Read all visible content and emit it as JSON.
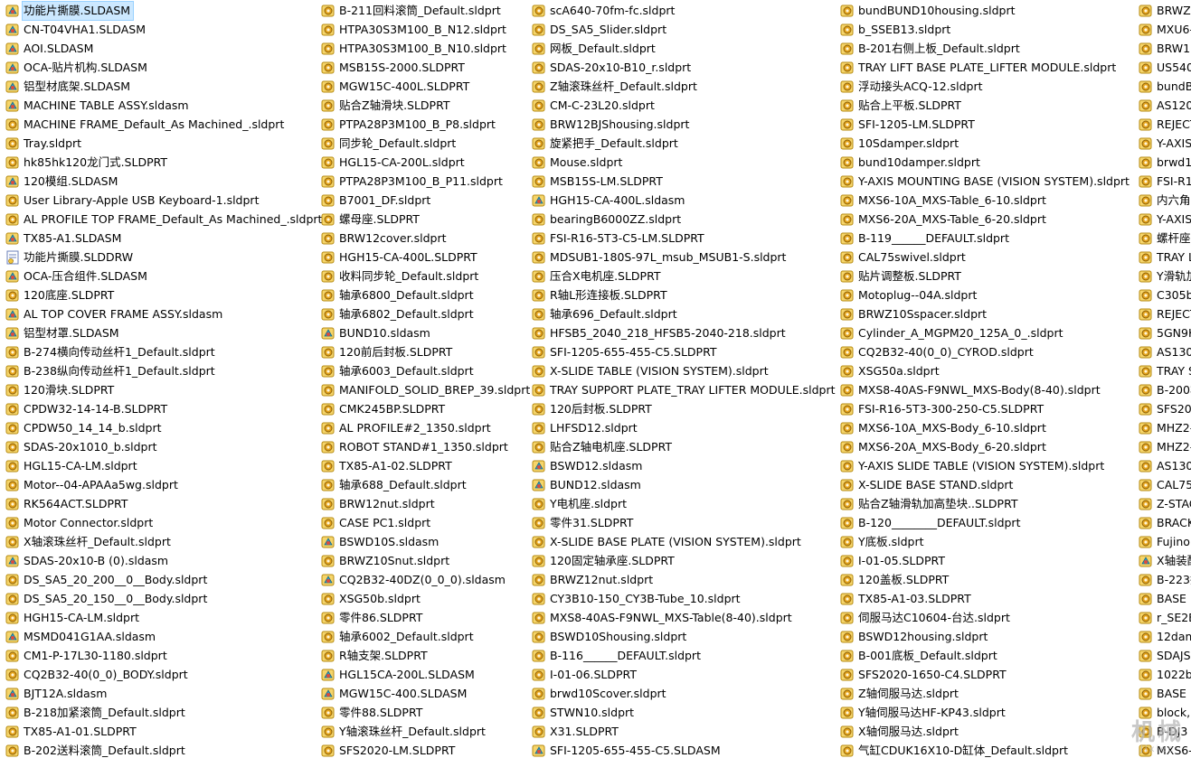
{
  "icon_kinds": {
    "a": "assembly-icon",
    "p": "part-icon",
    "d": "drawing-icon"
  },
  "colors": {
    "selection": "#cce8ff",
    "assembly": "#2fa0c8",
    "part": "#e3a21a",
    "drawing": "#6a7fb8"
  },
  "watermark": {
    "main": "机械",
    "sub": "Jixiec"
  },
  "columns": [
    [
      [
        "功能片撕膜.SLDASM",
        "a",
        true
      ],
      [
        "CN-T04VHA1.SLDASM",
        "a",
        false
      ],
      [
        "AOI.SLDASM",
        "a",
        false
      ],
      [
        "OCA-贴片机构.SLDASM",
        "a",
        false
      ],
      [
        "铝型材底架.SLDASM",
        "a",
        false
      ],
      [
        "MACHINE TABLE  ASSY.sldasm",
        "a",
        false
      ],
      [
        "MACHINE FRAME_Default_As Machined_.sldprt",
        "p",
        false
      ],
      [
        "Tray.sldprt",
        "p",
        false
      ],
      [
        "hk85hk120龙门式.SLDPRT",
        "p",
        false
      ],
      [
        "120模组.SLDASM",
        "a",
        false
      ],
      [
        "User Library-Apple USB Keyboard-1.sldprt",
        "p",
        false
      ],
      [
        "AL PROFILE TOP FRAME_Default_As Machined_.sldprt",
        "p",
        false
      ],
      [
        "TX85-A1.SLDASM",
        "a",
        false
      ],
      [
        "功能片撕膜.SLDDRW",
        "d",
        false
      ],
      [
        "OCA-压合组件.SLDASM",
        "a",
        false
      ],
      [
        "120底座.SLDPRT",
        "p",
        false
      ],
      [
        "AL TOP COVER FRAME  ASSY.sldasm",
        "a",
        false
      ],
      [
        "铝型材罩.SLDASM",
        "a",
        false
      ],
      [
        "B-274横向传动丝杆1_Default.sldprt",
        "p",
        false
      ],
      [
        "B-238纵向传动丝杆1_Default.sldprt",
        "p",
        false
      ],
      [
        "120滑块.SLDPRT",
        "p",
        false
      ],
      [
        "CPDW32-14-14-B.SLDPRT",
        "p",
        false
      ],
      [
        "CPDW50_14_14_b.sldprt",
        "p",
        false
      ],
      [
        "SDAS-20x1010_b.sldprt",
        "p",
        false
      ],
      [
        "HGL15-CA-LM.sldprt",
        "p",
        false
      ],
      [
        "Motor--04-APAAa5wg.sldprt",
        "p",
        false
      ],
      [
        "RK564ACT.SLDPRT",
        "p",
        false
      ],
      [
        "Motor Connector.sldprt",
        "p",
        false
      ],
      [
        "X轴滚珠丝杆_Default.sldprt",
        "p",
        false
      ],
      [
        "SDAS-20x10-B (0).sldasm",
        "a",
        false
      ],
      [
        "DS_SA5_20_200__0__Body.sldprt",
        "p",
        false
      ],
      [
        "DS_SA5_20_150__0__Body.sldprt",
        "p",
        false
      ],
      [
        "HGH15-CA-LM.sldprt",
        "p",
        false
      ],
      [
        "MSMD041G1AA.sldasm",
        "a",
        false
      ],
      [
        "CM1-P-17L30-1180.sldprt",
        "p",
        false
      ],
      [
        "CQ2B32-40(0_0)_BODY.sldprt",
        "p",
        false
      ],
      [
        "BJT12A.sldasm",
        "a",
        false
      ],
      [
        "B-218加紧滚筒_Default.sldprt",
        "p",
        false
      ],
      [
        "TX85-A1-01.SLDPRT",
        "p",
        false
      ],
      [
        "B-202送料滚筒_Default.sldprt",
        "p",
        false
      ]
    ],
    [
      [
        "B-211回料滚筒_Default.sldprt",
        "p",
        false
      ],
      [
        "HTPA30S3M100_B_N12.sldprt",
        "p",
        false
      ],
      [
        "HTPA30S3M100_B_N10.sldprt",
        "p",
        false
      ],
      [
        "MSB15S-2000.SLDPRT",
        "p",
        false
      ],
      [
        "MGW15C-400L.SLDPRT",
        "p",
        false
      ],
      [
        "贴合Z轴滑块.SLDPRT",
        "p",
        false
      ],
      [
        "PTPA28P3M100_B_P8.sldprt",
        "p",
        false
      ],
      [
        "同步轮_Default.sldprt",
        "p",
        false
      ],
      [
        "HGL15-CA-200L.sldprt",
        "p",
        false
      ],
      [
        "PTPA28P3M100_B_P11.sldprt",
        "p",
        false
      ],
      [
        "B7001_DF.sldprt",
        "p",
        false
      ],
      [
        "螺母座.SLDPRT",
        "p",
        false
      ],
      [
        "BRW12cover.sldprt",
        "p",
        false
      ],
      [
        "HGH15-CA-400L.SLDPRT",
        "p",
        false
      ],
      [
        "收料同步轮_Default.sldprt",
        "p",
        false
      ],
      [
        "轴承6800_Default.sldprt",
        "p",
        false
      ],
      [
        "轴承6802_Default.sldprt",
        "p",
        false
      ],
      [
        "BUND10.sldasm",
        "a",
        false
      ],
      [
        "120前后封板.SLDPRT",
        "p",
        false
      ],
      [
        "轴承6003_Default.sldprt",
        "p",
        false
      ],
      [
        "MANIFOLD_SOLID_BREP_39.sldprt",
        "p",
        false
      ],
      [
        "CMK245BP.SLDPRT",
        "p",
        false
      ],
      [
        "AL PROFILE#2_1350.sldprt",
        "p",
        false
      ],
      [
        "ROBOT STAND#1_1350.sldprt",
        "p",
        false
      ],
      [
        "TX85-A1-02.SLDPRT",
        "p",
        false
      ],
      [
        "轴承688_Default.sldprt",
        "p",
        false
      ],
      [
        "BRW12nut.sldprt",
        "p",
        false
      ],
      [
        "CASE PC1.sldprt",
        "p",
        false
      ],
      [
        "BSWD10S.sldasm",
        "a",
        false
      ],
      [
        "BRWZ10Snut.sldprt",
        "p",
        false
      ],
      [
        "CQ2B32-40DZ(0_0_0).sldasm",
        "a",
        false
      ],
      [
        "XSG50b.sldprt",
        "p",
        false
      ],
      [
        "零件86.SLDPRT",
        "p",
        false
      ],
      [
        "轴承6002_Default.sldprt",
        "p",
        false
      ],
      [
        "R轴支架.SLDPRT",
        "p",
        false
      ],
      [
        "HGL15CA-200L.SLDASM",
        "a",
        false
      ],
      [
        "MGW15C-400.SLDASM",
        "a",
        false
      ],
      [
        "零件88.SLDPRT",
        "p",
        false
      ],
      [
        "Y轴滚珠丝杆_Default.sldprt",
        "p",
        false
      ],
      [
        "SFS2020-LM.SLDPRT",
        "p",
        false
      ]
    ],
    [
      [
        "scA640-70fm-fc.sldprt",
        "p",
        false
      ],
      [
        "DS_SA5_Slider.sldprt",
        "p",
        false
      ],
      [
        "网板_Default.sldprt",
        "p",
        false
      ],
      [
        "SDAS-20x10-B10_r.sldprt",
        "p",
        false
      ],
      [
        "Z轴滚珠丝杆_Default.sldprt",
        "p",
        false
      ],
      [
        "CM-C-23L20.sldprt",
        "p",
        false
      ],
      [
        "BRW12BJShousing.sldprt",
        "p",
        false
      ],
      [
        "旋紧把手_Default.sldprt",
        "p",
        false
      ],
      [
        "Mouse.sldprt",
        "p",
        false
      ],
      [
        "MSB15S-LM.SLDPRT",
        "p",
        false
      ],
      [
        "HGH15-CA-400L.sldasm",
        "a",
        false
      ],
      [
        "bearingB6000ZZ.sldprt",
        "p",
        false
      ],
      [
        "FSI-R16-5T3-C5-LM.SLDPRT",
        "p",
        false
      ],
      [
        "MDSUB1-180S-97L_msub_MSUB1-S.sldprt",
        "p",
        false
      ],
      [
        "压合X电机座.SLDPRT",
        "p",
        false
      ],
      [
        "R轴L形连接板.SLDPRT",
        "p",
        false
      ],
      [
        "轴承696_Default.sldprt",
        "p",
        false
      ],
      [
        "HFSB5_2040_218_HFSB5-2040-218.sldprt",
        "p",
        false
      ],
      [
        "SFI-1205-655-455-C5.SLDPRT",
        "p",
        false
      ],
      [
        "X-SLIDE TABLE (VISION SYSTEM).sldprt",
        "p",
        false
      ],
      [
        "TRAY SUPPORT PLATE_TRAY  LIFTER MODULE.sldprt",
        "p",
        false
      ],
      [
        "120后封板.SLDPRT",
        "p",
        false
      ],
      [
        "LHFSD12.sldprt",
        "p",
        false
      ],
      [
        "贴合Z轴电机座.SLDPRT",
        "p",
        false
      ],
      [
        "BSWD12.sldasm",
        "a",
        false
      ],
      [
        "BUND12.sldasm",
        "a",
        false
      ],
      [
        "Y电机座.sldprt",
        "p",
        false
      ],
      [
        "零件31.SLDPRT",
        "p",
        false
      ],
      [
        "X-SLIDE BASE PLATE (VISION SYSTEM).sldprt",
        "p",
        false
      ],
      [
        "120固定轴承座.SLDPRT",
        "p",
        false
      ],
      [
        "BRWZ12nut.sldprt",
        "p",
        false
      ],
      [
        "CY3B10-150_CY3B-Tube_10.sldprt",
        "p",
        false
      ],
      [
        "MXS8-40AS-F9NWL_MXS-Table(8-40).sldprt",
        "p",
        false
      ],
      [
        "BSWD10Shousing.sldprt",
        "p",
        false
      ],
      [
        "B-116______DEFAULT.sldprt",
        "p",
        false
      ],
      [
        "I-01-06.SLDPRT",
        "p",
        false
      ],
      [
        "brwd10Scover.sldprt",
        "p",
        false
      ],
      [
        "STWN10.sldprt",
        "p",
        false
      ],
      [
        "X31.SLDPRT",
        "p",
        false
      ],
      [
        "SFI-1205-655-455-C5.SLDASM",
        "a",
        false
      ]
    ],
    [
      [
        "bundBUND10housing.sldprt",
        "p",
        false
      ],
      [
        "b_SSEB13.sldprt",
        "p",
        false
      ],
      [
        "B-201右侧上板_Default.sldprt",
        "p",
        false
      ],
      [
        "TRAY LIFT BASE PLATE_LIFTER MODULE.sldprt",
        "p",
        false
      ],
      [
        "浮动接头ACQ-12.sldprt",
        "p",
        false
      ],
      [
        "贴合上平板.SLDPRT",
        "p",
        false
      ],
      [
        "SFI-1205-LM.SLDPRT",
        "p",
        false
      ],
      [
        "10Sdamper.sldprt",
        "p",
        false
      ],
      [
        "bund10damper.sldprt",
        "p",
        false
      ],
      [
        "Y-AXIS MOUNTING BASE (VISION SYSTEM).sldprt",
        "p",
        false
      ],
      [
        "MXS6-10A_MXS-Table_6-10.sldprt",
        "p",
        false
      ],
      [
        "MXS6-20A_MXS-Table_6-20.sldprt",
        "p",
        false
      ],
      [
        "B-119______DEFAULT.sldprt",
        "p",
        false
      ],
      [
        "CAL75swivel.sldprt",
        "p",
        false
      ],
      [
        "贴片调整板.SLDPRT",
        "p",
        false
      ],
      [
        "Motoplug--04A.sldprt",
        "p",
        false
      ],
      [
        "BRWZ10Sspacer.sldprt",
        "p",
        false
      ],
      [
        "Cylinder_A_MGPM20_125A_0_.sldprt",
        "p",
        false
      ],
      [
        "CQ2B32-40(0_0)_CYROD.sldprt",
        "p",
        false
      ],
      [
        "XSG50a.sldprt",
        "p",
        false
      ],
      [
        "MXS8-40AS-F9NWL_MXS-Body(8-40).sldprt",
        "p",
        false
      ],
      [
        "FSI-R16-5T3-300-250-C5.SLDPRT",
        "p",
        false
      ],
      [
        "MXS6-10A_MXS-Body_6-10.sldprt",
        "p",
        false
      ],
      [
        "MXS6-20A_MXS-Body_6-20.sldprt",
        "p",
        false
      ],
      [
        "Y-AXIS SLIDE TABLE (VISION SYSTEM).sldprt",
        "p",
        false
      ],
      [
        "X-SLIDE BASE STAND.sldprt",
        "p",
        false
      ],
      [
        "贴合Z轴滑轨加高垫块..SLDPRT",
        "p",
        false
      ],
      [
        "B-120________DEFAULT.sldprt",
        "p",
        false
      ],
      [
        "Y底板.sldprt",
        "p",
        false
      ],
      [
        "I-01-05.SLDPRT",
        "p",
        false
      ],
      [
        "120盖板.SLDPRT",
        "p",
        false
      ],
      [
        "TX85-A1-03.SLDPRT",
        "p",
        false
      ],
      [
        "伺服马达C10604-台达.sldprt",
        "p",
        false
      ],
      [
        "BSWD12housing.sldprt",
        "p",
        false
      ],
      [
        "B-001底板_Default.sldprt",
        "p",
        false
      ],
      [
        "SFS2020-1650-C4.SLDPRT",
        "p",
        false
      ],
      [
        "Z轴伺服马达.sldprt",
        "p",
        false
      ],
      [
        "Y轴伺服马达HF-KP43.sldprt",
        "p",
        false
      ],
      [
        "X轴伺服马达.sldprt",
        "p",
        false
      ],
      [
        "气缸CDUK16X10-D缸体_Default.sldprt",
        "p",
        false
      ]
    ],
    [
      [
        "BRWZ1",
        "p",
        false
      ],
      [
        "MXU6-",
        "p",
        false
      ],
      [
        "BRW12",
        "p",
        false
      ],
      [
        "US540-",
        "p",
        false
      ],
      [
        "bundBU",
        "p",
        false
      ],
      [
        "AS1201",
        "p",
        false
      ],
      [
        "REJECT",
        "p",
        false
      ],
      [
        "Y-AXIS",
        "p",
        false
      ],
      [
        "brwd12",
        "p",
        false
      ],
      [
        "FSI-R16",
        "p",
        false
      ],
      [
        "内六角E",
        "p",
        false
      ],
      [
        "Y-AXIS",
        "p",
        false
      ],
      [
        "螺杆座.",
        "p",
        false
      ],
      [
        "TRAY L",
        "p",
        false
      ],
      [
        "Y滑轨加",
        "p",
        false
      ],
      [
        "C305bs",
        "p",
        false
      ],
      [
        "REJECT",
        "p",
        false
      ],
      [
        "5GN9K",
        "p",
        false
      ],
      [
        "AS1301",
        "p",
        false
      ],
      [
        "TRAY S",
        "p",
        false
      ],
      [
        "B-200右",
        "p",
        false
      ],
      [
        "SFS202",
        "p",
        false
      ],
      [
        "MHZ2-",
        "p",
        false
      ],
      [
        "MHZ2-",
        "p",
        false
      ],
      [
        "AS1301",
        "p",
        false
      ],
      [
        "CAL75b",
        "p",
        false
      ],
      [
        "Z-STAG",
        "p",
        false
      ],
      [
        "BRACK",
        "p",
        false
      ],
      [
        "Fujinon",
        "p",
        false
      ],
      [
        "X轴装配",
        "a",
        false
      ],
      [
        "B-223搁",
        "p",
        false
      ],
      [
        "BASE P",
        "p",
        false
      ],
      [
        "r_SE2B",
        "p",
        false
      ],
      [
        "12dam",
        "p",
        false
      ],
      [
        "SDAJS",
        "p",
        false
      ],
      [
        "1022bs",
        "p",
        false
      ],
      [
        "BASE P",
        "p",
        false
      ],
      [
        "block,",
        "p",
        false
      ],
      [
        "B-DJ3",
        "p",
        false
      ],
      [
        "MXS6-",
        "p",
        false
      ]
    ]
  ]
}
